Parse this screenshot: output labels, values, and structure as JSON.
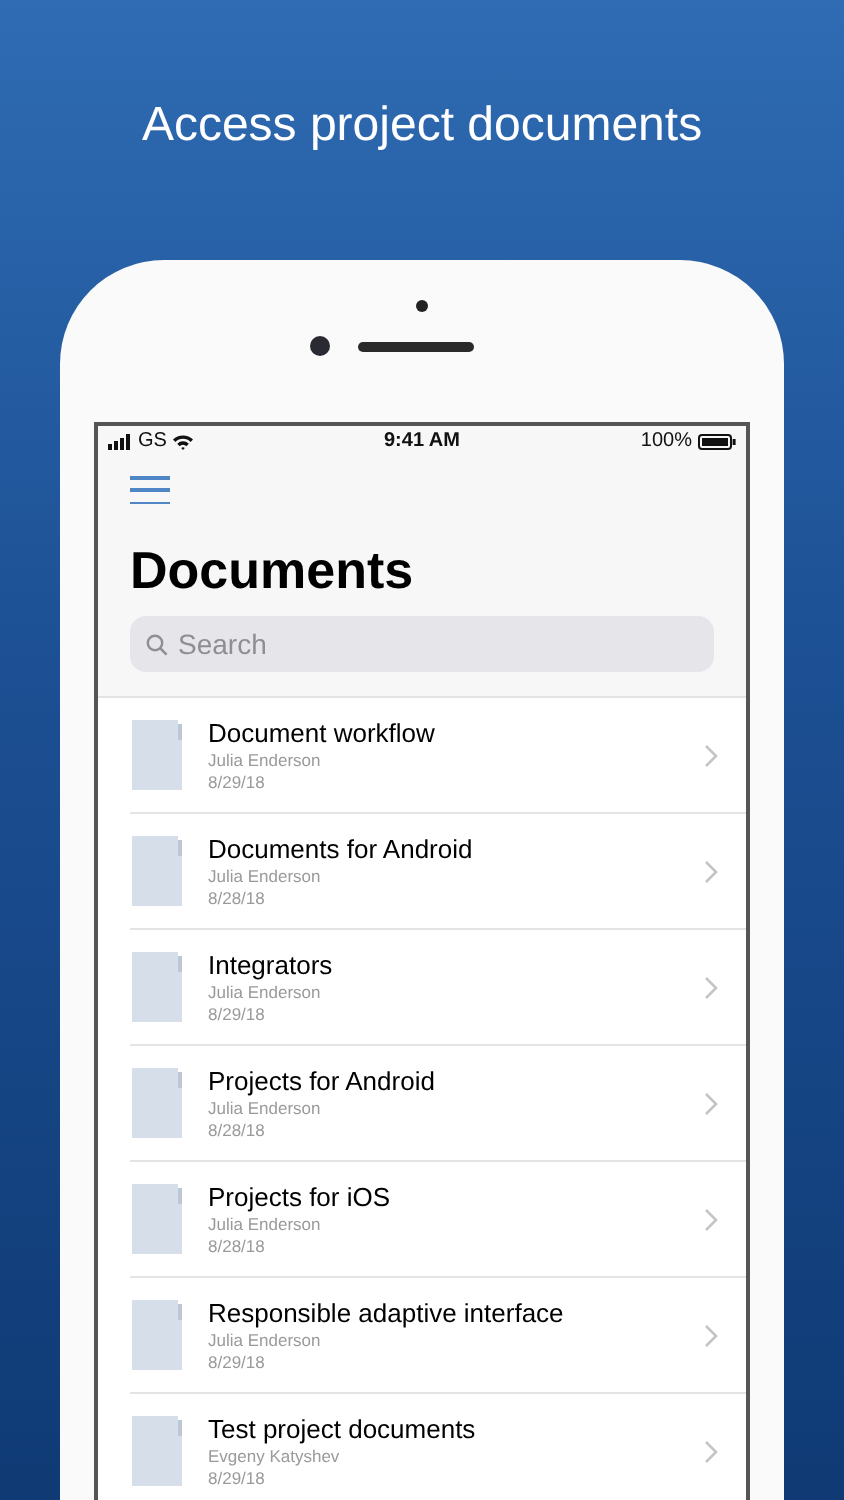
{
  "headline": "Access project documents",
  "status_bar": {
    "carrier": "GS",
    "time": "9:41 AM",
    "battery": "100%"
  },
  "title": "Documents",
  "search": {
    "placeholder": "Search"
  },
  "documents": [
    {
      "name": "Document workflow",
      "author": "Julia Enderson",
      "date": "8/29/18"
    },
    {
      "name": "Documents for Android",
      "author": "Julia Enderson",
      "date": "8/28/18"
    },
    {
      "name": "Integrators",
      "author": "Julia Enderson",
      "date": "8/29/18"
    },
    {
      "name": "Projects for Android",
      "author": "Julia Enderson",
      "date": "8/28/18"
    },
    {
      "name": "Projects for iOS",
      "author": "Julia Enderson",
      "date": "8/28/18"
    },
    {
      "name": "Responsible adaptive interface",
      "author": "Julia Enderson",
      "date": "8/29/18"
    },
    {
      "name": "Test project documents",
      "author": "Evgeny Katyshev",
      "date": "8/29/18"
    }
  ]
}
